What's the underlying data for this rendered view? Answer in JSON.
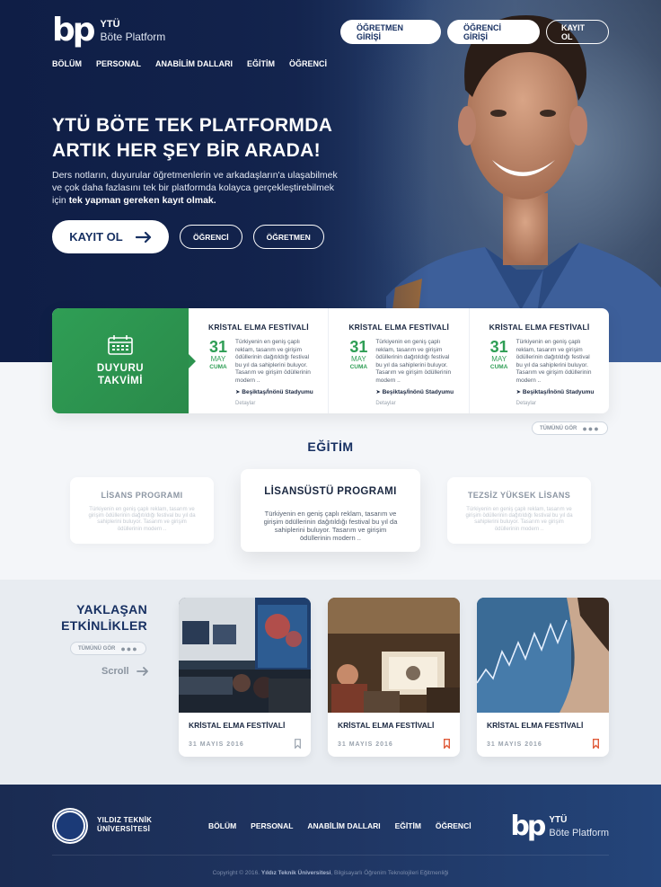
{
  "brand": {
    "mark": "bp",
    "line1": "YTÜ",
    "line2": "Böte Platform"
  },
  "header": {
    "buttons": [
      "ÖĞRETMEN GİRİŞİ",
      "ÖĞRENCİ GİRİŞİ",
      "KAYIT OL"
    ],
    "nav": [
      "BÖLÜM",
      "PERSONAL",
      "ANABİLİM DALLARI",
      "EĞİTİM",
      "ÖĞRENCİ"
    ]
  },
  "hero": {
    "title_line1": "YTÜ BÖTE TEK PLATFORMDA",
    "title_line2": "ARTIK HER ŞEY BİR ARADA!",
    "desc": "Ders notların, duyurular öğretmenlerin ve arkadaşların'a ulaşabilmek ve çok daha fazlasını tek bir platformda kolayca gerçekleştirebilmek için ",
    "desc_bold": "tek yapman gereken kayıt olmak.",
    "cta": "KAYIT OL",
    "btn_student": "ÖĞRENCİ",
    "btn_teacher": "ÖĞRETMEN"
  },
  "announcements": {
    "title_line1": "DUYURU",
    "title_line2": "TAKVİMİ",
    "items": [
      {
        "title": "KRİSTAL ELMA FESTİVALİ",
        "day": "31",
        "month": "MAY",
        "weekday": "CUMA",
        "desc": "Türkiyenin en geniş çaplı reklam, tasarım ve girişim ödüllerinin dağıtıldığı festival bu yıl da sahiplerini buluyor. Tasarım ve girişim ödüllerinin modern ..",
        "location": "Beşiktaş/İnönü Stadyumu",
        "details": "Detaylar"
      },
      {
        "title": "KRİSTAL ELMA FESTİVALİ",
        "day": "31",
        "month": "MAY",
        "weekday": "CUMA",
        "desc": "Türkiyenin en geniş çaplı reklam, tasarım ve girişim ödüllerinin dağıtıldığı festival bu yıl da sahiplerini buluyor. Tasarım ve girişim ödüllerinin modern ..",
        "location": "Beşiktaş/İnönü Stadyumu",
        "details": "Detaylar"
      },
      {
        "title": "KRİSTAL ELMA FESTİVALİ",
        "day": "31",
        "month": "MAY",
        "weekday": "CUMA",
        "desc": "Türkiyenin en geniş çaplı reklam, tasarım ve girişim ödüllerinin dağıtıldığı festival bu yıl da sahiplerini buluyor. Tasarım ve girişim ödüllerinin modern ..",
        "location": "Beşiktaş/İnönü Stadyumu",
        "details": "Detaylar"
      }
    ],
    "see_all": "TÜMÜNÜ GÖR"
  },
  "education": {
    "title": "EĞİTİM",
    "cards": [
      {
        "title": "LİSANS PROGRAMI",
        "desc": "Türkiyenin en geniş çaplı reklam, tasarım ve girişim ödüllerinin dağıtıldığı festival bu yıl da sahiplerini buluyor. Tasarım ve girişim ödüllerinin  modern .."
      },
      {
        "title": "LİSANSÜSTÜ PROGRAMI",
        "desc": "Türkiyenin en geniş çaplı reklam, tasarım ve girişim ödüllerinin dağıtıldığı festival bu yıl da sahiplerini buluyor. Tasarım ve girişim ödüllerinin  modern .."
      },
      {
        "title": "TEZSİZ YÜKSEK LİSANS",
        "desc": "Türkiyenin en geniş çaplı reklam, tasarım ve girişim ödüllerinin dağıtıldığı festival bu yıl da sahiplerini buluyor. Tasarım ve girişim ödüllerinin  modern .."
      }
    ]
  },
  "events": {
    "title_line1": "YAKLAŞAN",
    "title_line2": "ETKİNLİKLER",
    "see_all": "TÜMÜNÜ GÖR",
    "scroll": "Scroll",
    "items": [
      {
        "title": "KRİSTAL ELMA FESTİVALİ",
        "date": "31 MAYIS 2016"
      },
      {
        "title": "KRİSTAL ELMA FESTİVALİ",
        "date": "31 MAYIS 2016"
      },
      {
        "title": "KRİSTAL ELMA FESTİVALİ",
        "date": "31 MAYIS 2016"
      }
    ]
  },
  "footer": {
    "uni_line1": "YILDIZ TEKNİK",
    "uni_line2": "ÜNİVERSİTESİ",
    "nav": [
      "BÖLÜM",
      "PERSONAL",
      "ANABİLİM DALLARI",
      "EĞİTİM",
      "ÖĞRENCİ"
    ],
    "copy_prefix": "Copyright © 2016. ",
    "copy_bold": "Yıldız Teknik Üniversitesi",
    "copy_suffix": ", Bilgisayarlı Öğrenim Teknolojileri Eğitmenliği"
  },
  "colors": {
    "navy": "#173062",
    "green": "#2f9e55",
    "bookmark_active": "#e05b3a",
    "bookmark_inactive": "#9aa3ae"
  }
}
